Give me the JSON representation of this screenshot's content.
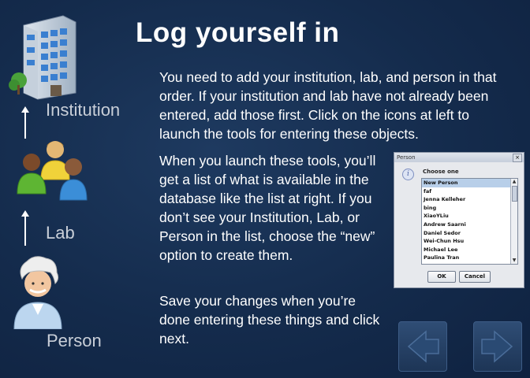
{
  "title": "Log yourself in",
  "paragraphs": {
    "p1": "You need to add your institution, lab, and person in that order.  If your institution and lab have not already been entered, add those first.  Click on the icons at left to launch the tools for entering these objects.",
    "p2": "When you launch these tools, you’ll get a list of what is available in the database like the list at right.  If you don’t see your Institution, Lab, or Person in the list, choose the “new” option to create them.",
    "p3": "Save your changes when you’re done entering these things and click next."
  },
  "sidebar": {
    "institution": {
      "label": "Institution",
      "icon": "building-icon"
    },
    "lab": {
      "label": "Lab",
      "icon": "group-icon"
    },
    "person": {
      "label": "Person",
      "icon": "person-icon"
    }
  },
  "dialog": {
    "title": "Person",
    "close": "×",
    "info": "i",
    "prompt": "Choose one",
    "items": [
      "New Person",
      "faf",
      "Jenna Kelleher",
      "bing",
      "XiaoYLiu",
      "Andrew Saarni",
      "Daniel Sedor",
      "Wei-Chun Hsu",
      "Michael Lee",
      "Paulina Tran"
    ],
    "selected": "New Person",
    "ok_label": "OK",
    "cancel_label": "Cancel"
  },
  "nav": {
    "back": "back-arrow-icon",
    "next": "next-arrow-icon"
  },
  "colors": {
    "background": "#142b4c",
    "title": "#ffffff",
    "label": "#c9cfd8"
  }
}
